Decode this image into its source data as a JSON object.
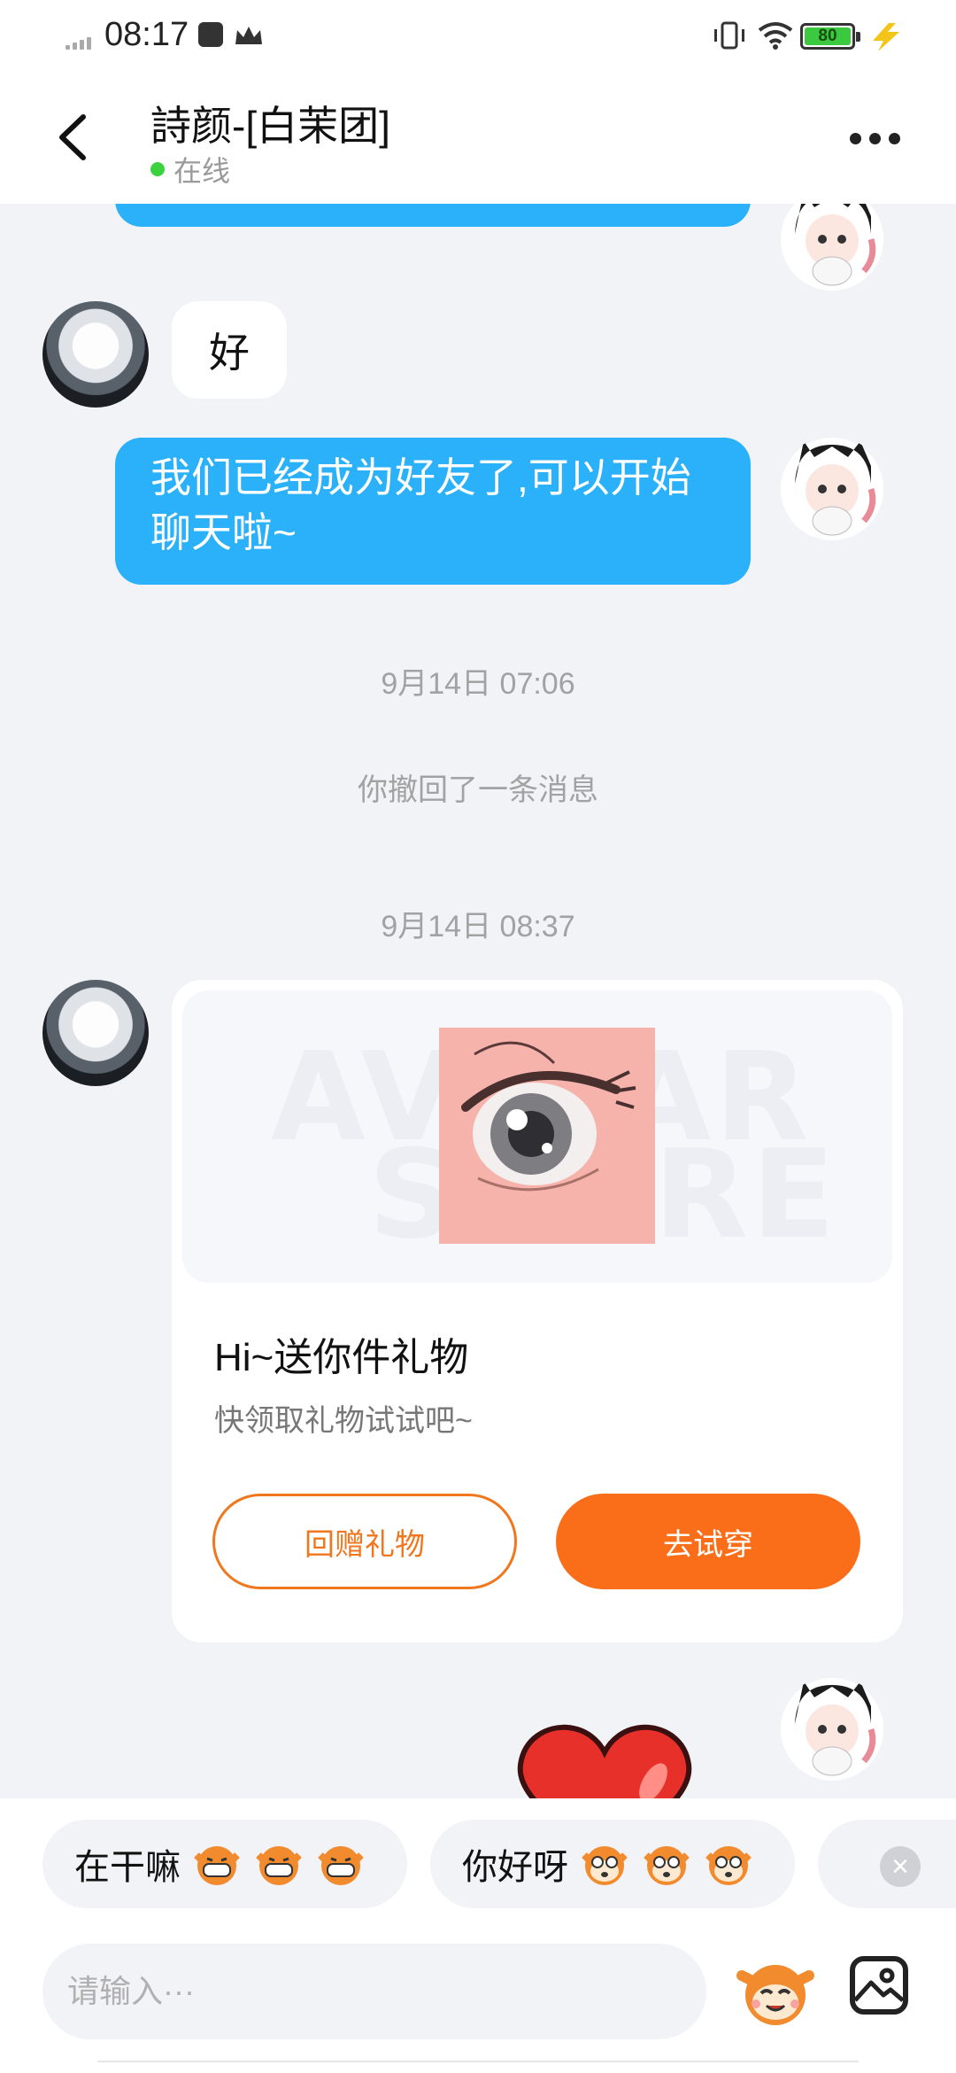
{
  "status_bar": {
    "time": "08:17",
    "battery": "80",
    "icons": [
      "signal-icon",
      "notification-square-icon",
      "crown-icon",
      "vibrate-icon",
      "wifi-icon",
      "battery-icon",
      "charging-bolt-icon"
    ]
  },
  "header": {
    "title": "詩颜-[白茉团]",
    "status": "在线",
    "status_color": "#3ad23f"
  },
  "messages": [
    {
      "from": "self",
      "text": "我们已经成为好友了,可以开始聊天啦~"
    },
    {
      "from": "friend",
      "text": "好"
    }
  ],
  "timestamps": [
    "9月14日 07:06",
    "9月14日 08:37"
  ],
  "system_notice": "你撤回了一条消息",
  "gift_card": {
    "watermark_line1": "AVATAR",
    "watermark_line2": "STORE",
    "title": "Hi~送你件礼物",
    "subtitle": "快领取礼物试试吧~",
    "return_button": "回赠礼物",
    "try_button": "去试穿"
  },
  "quick_replies": [
    "在干嘛",
    "你好呀"
  ],
  "input": {
    "placeholder": "请输入···"
  },
  "colors": {
    "self_bubble": "#2ab1fa",
    "accent_orange": "#fa6e1a",
    "background": "#f2f3f7"
  }
}
